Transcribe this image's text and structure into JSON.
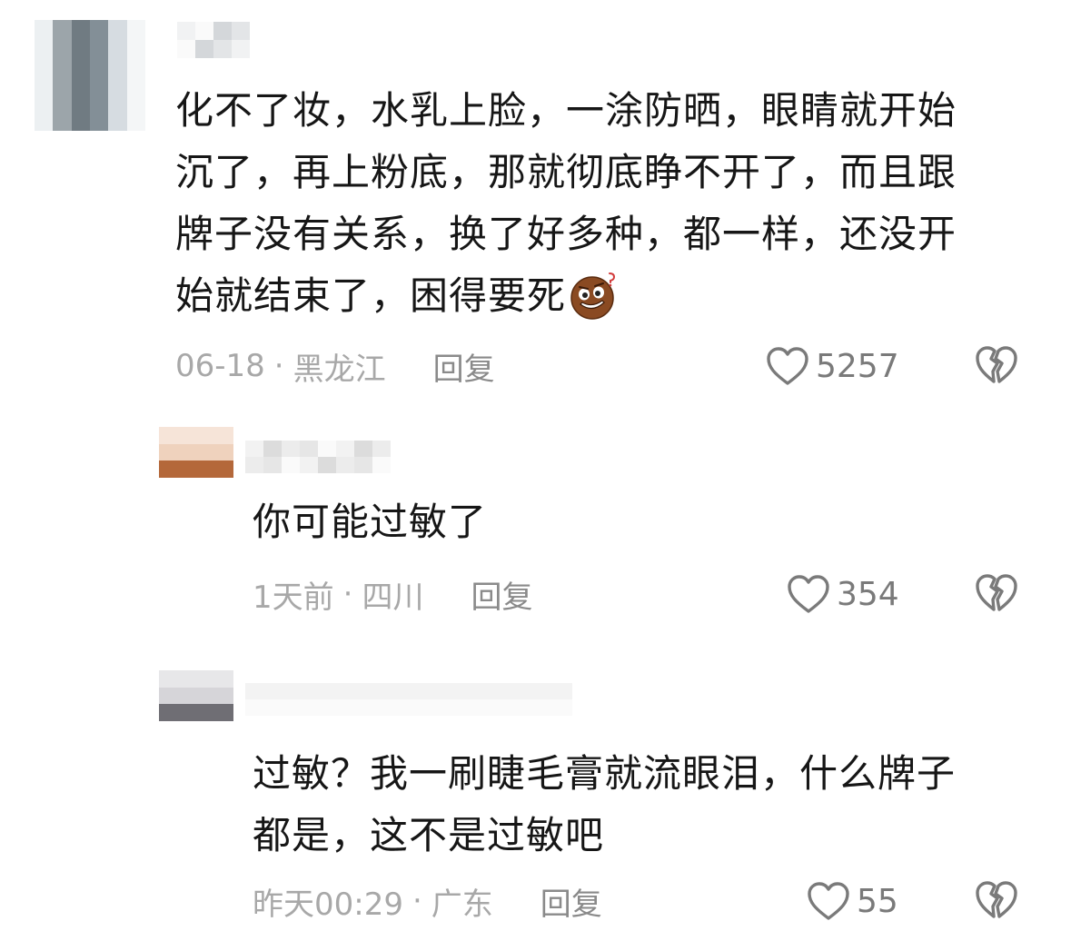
{
  "comments": {
    "main": {
      "text_lines": [
        "化不了妆，水乳上脸，一涂防晒，眼睛就开始",
        "沉了，再上粉底，那就彻底睁不开了，而且跟",
        "牌子没有关系，换了好多种，都一样，还没开",
        "始就结束了，困得要死"
      ],
      "emoji": "sweating-sleepy-emoji",
      "date": "06-18",
      "separator": "·",
      "location": "黑龙江",
      "reply_label": "回复",
      "likes": "5257"
    },
    "replies": [
      {
        "text_lines": [
          "你可能过敏了"
        ],
        "date": "1天前",
        "separator": "·",
        "location": "四川",
        "reply_label": "回复",
        "likes": "354"
      },
      {
        "text_lines": [
          "过敏？我一刷睫毛膏就流眼泪，什么牌子",
          "都是，这不是过敏吧"
        ],
        "date": "昨天00:29",
        "separator": "·",
        "location": "广东",
        "reply_label": "回复",
        "likes": "55"
      }
    ]
  },
  "icons": {
    "like": "heart-outline-icon",
    "dislike": "broken-heart-icon"
  },
  "colors": {
    "text": "#161616",
    "meta": "#a8a8a8",
    "reply": "#8a8a8a",
    "icon": "#7a7a7a"
  }
}
